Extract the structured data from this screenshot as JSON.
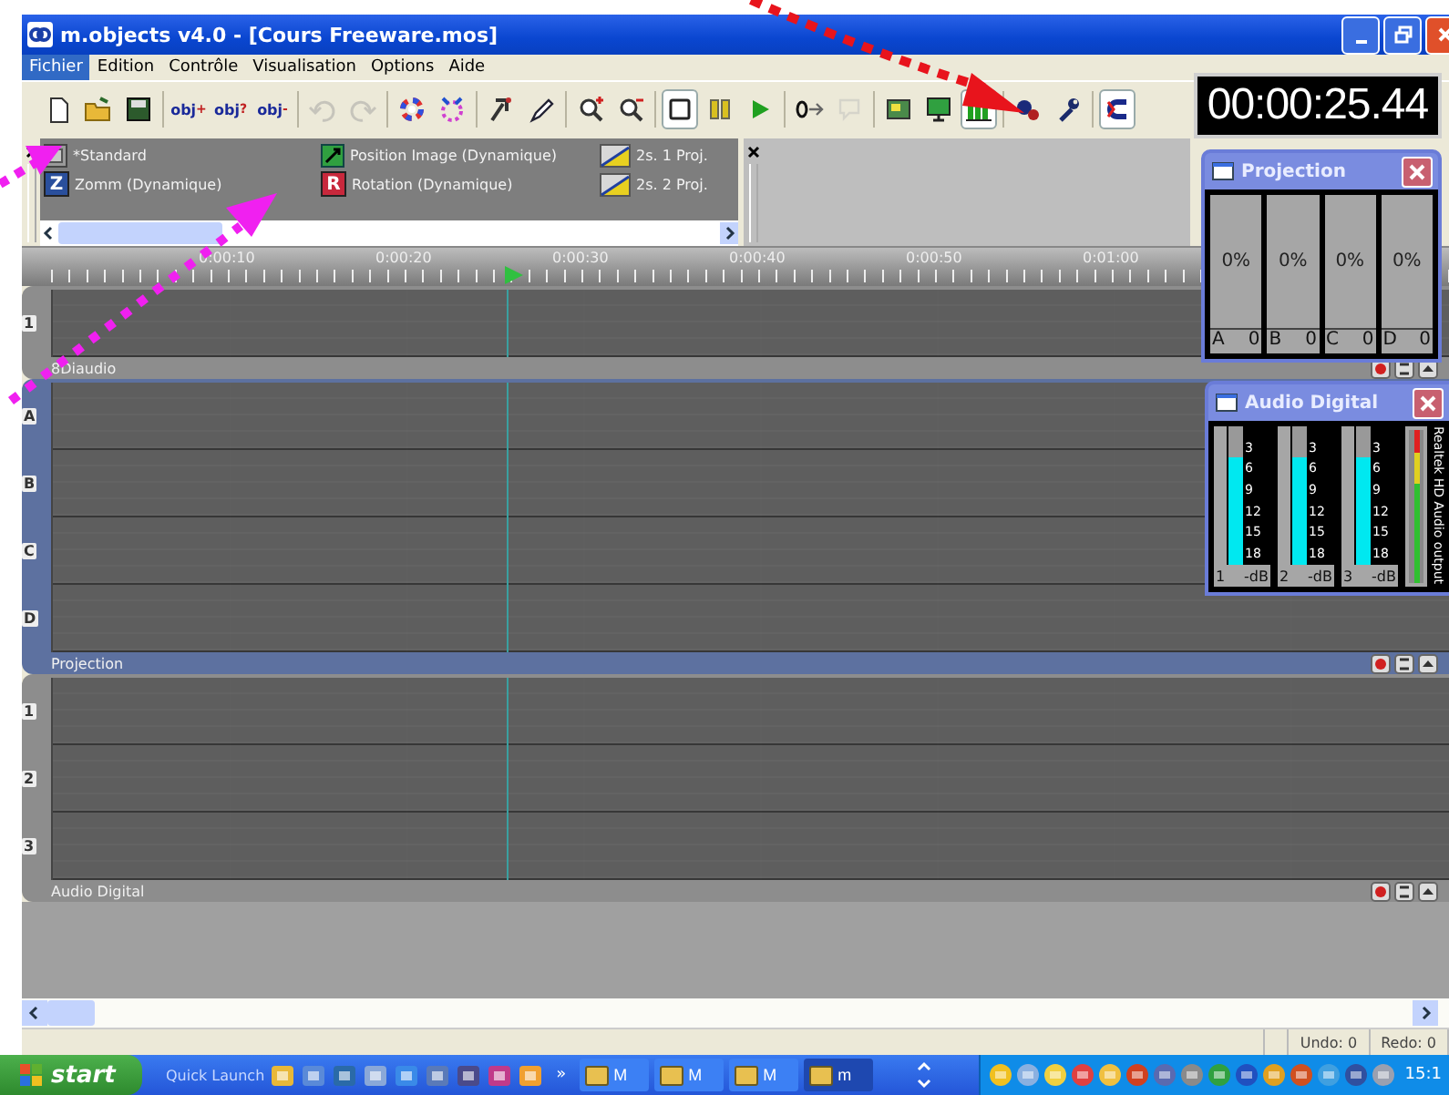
{
  "window": {
    "title": "m.objects v4.0 - [Cours Freeware.mos]"
  },
  "menu": [
    {
      "label": "Fichier",
      "selected": true
    },
    {
      "label": "Edition",
      "selected": false
    },
    {
      "label": "Contrôle",
      "selected": false
    },
    {
      "label": "Visualisation",
      "selected": false
    },
    {
      "label": "Options",
      "selected": false
    },
    {
      "label": "Aide",
      "selected": false
    }
  ],
  "toolbar": [
    {
      "kind": "icon",
      "pressed": false,
      "disabled": false
    },
    {
      "kind": "icon",
      "pressed": false,
      "disabled": false
    },
    {
      "kind": "icon",
      "pressed": false,
      "disabled": false
    },
    {
      "kind": "separator"
    },
    {
      "kind": "text",
      "label": "obj",
      "sup": "+",
      "pressed": false
    },
    {
      "kind": "text",
      "label": "obj",
      "sup": "?",
      "pressed": false
    },
    {
      "kind": "text",
      "label": "obj",
      "sup": "-",
      "pressed": false
    },
    {
      "kind": "separator"
    },
    {
      "kind": "icon",
      "pressed": false,
      "disabled": true
    },
    {
      "kind": "icon",
      "pressed": false,
      "disabled": true
    },
    {
      "kind": "separator"
    },
    {
      "kind": "icon",
      "pressed": false,
      "disabled": false
    },
    {
      "kind": "icon",
      "pressed": false,
      "disabled": false
    },
    {
      "kind": "separator"
    },
    {
      "kind": "icon",
      "pressed": false,
      "disabled": false
    },
    {
      "kind": "icon",
      "pressed": false,
      "disabled": false
    },
    {
      "kind": "separator"
    },
    {
      "kind": "icon",
      "pressed": false,
      "disabled": false
    },
    {
      "kind": "icon",
      "pressed": false,
      "disabled": false
    },
    {
      "kind": "separator"
    },
    {
      "kind": "icon",
      "pressed": true,
      "disabled": false
    },
    {
      "kind": "icon",
      "pressed": false,
      "disabled": false
    },
    {
      "kind": "icon",
      "pressed": false,
      "disabled": false
    },
    {
      "kind": "separator"
    },
    {
      "kind": "icon",
      "pressed": false,
      "disabled": false
    },
    {
      "kind": "icon",
      "pressed": false,
      "disabled": true
    },
    {
      "kind": "separator"
    },
    {
      "kind": "icon",
      "pressed": false,
      "disabled": false
    },
    {
      "kind": "icon",
      "pressed": false,
      "disabled": false
    },
    {
      "kind": "icon",
      "pressed": true,
      "disabled": false
    },
    {
      "kind": "separator"
    },
    {
      "kind": "icon",
      "pressed": false,
      "disabled": false
    },
    {
      "kind": "icon",
      "pressed": false,
      "disabled": false
    },
    {
      "kind": "separator"
    },
    {
      "kind": "icon",
      "pressed": true,
      "disabled": false
    }
  ],
  "timecode": "00:00:25.44",
  "palette": {
    "items": [
      {
        "label": "*Standard",
        "kind": "standard"
      },
      {
        "label": "Position Image (Dynamique)",
        "kind": "position"
      },
      {
        "label": "2s. 1 Proj.",
        "kind": "fade"
      },
      {
        "label": "Zomm (Dynamique)",
        "kind": "letter",
        "letter": "Z",
        "color": "#2a4f9c"
      },
      {
        "label": "Rotation (Dynamique)",
        "kind": "letter",
        "letter": "R",
        "color": "#c8283c"
      },
      {
        "label": "2s. 2 Proj.",
        "kind": "fade"
      }
    ]
  },
  "ruler": {
    "labels": [
      "0:00:10",
      "0:00:20",
      "0:00:30",
      "0:00:40",
      "0:00:50",
      "0:01:00"
    ],
    "playhead": {
      "level": 0.338
    }
  },
  "track_groups": [
    {
      "label": "8Diaudio",
      "kind": "gray",
      "tracks": [
        "1"
      ]
    },
    {
      "label": "Projection",
      "kind": "blue",
      "tracks": [
        "A",
        "B",
        "C",
        "D"
      ]
    },
    {
      "label": "Audio Digital",
      "kind": "gray",
      "tracks": [
        "1",
        "2",
        "3"
      ]
    }
  ],
  "projection_window": {
    "title": "Projection",
    "channels": [
      {
        "percent": "0%",
        "letter": "A",
        "value": "0"
      },
      {
        "percent": "0%",
        "letter": "B",
        "value": "0"
      },
      {
        "percent": "0%",
        "letter": "C",
        "value": "0"
      },
      {
        "percent": "0%",
        "letter": "D",
        "value": "0"
      }
    ]
  },
  "audio_window": {
    "title": "Audio Digital",
    "channels": [
      {
        "number": "1",
        "unit": "-dB",
        "level": 0.78,
        "scale": [
          "3",
          "6",
          "9",
          "12",
          "15",
          "18"
        ]
      },
      {
        "number": "2",
        "unit": "-dB",
        "level": 0.78,
        "scale": [
          "3",
          "6",
          "9",
          "12",
          "15",
          "18"
        ]
      },
      {
        "number": "3",
        "unit": "-dB",
        "level": 0.78,
        "scale": [
          "3",
          "6",
          "9",
          "12",
          "15",
          "18"
        ]
      }
    ],
    "master": {
      "label": "Realtek HD Audio output",
      "level": 1
    }
  },
  "status_bar": {
    "undo": "Undo: 0",
    "redo": "Redo: 0"
  },
  "taskbar": {
    "start": "start",
    "quick_launch": "Quick Launch",
    "chevron": "»",
    "buttons": [
      {
        "label": "M",
        "selected": false
      },
      {
        "label": "M",
        "selected": false
      },
      {
        "label": "M",
        "selected": false
      },
      {
        "label": "m",
        "selected": true
      }
    ],
    "clock": "15:1"
  }
}
